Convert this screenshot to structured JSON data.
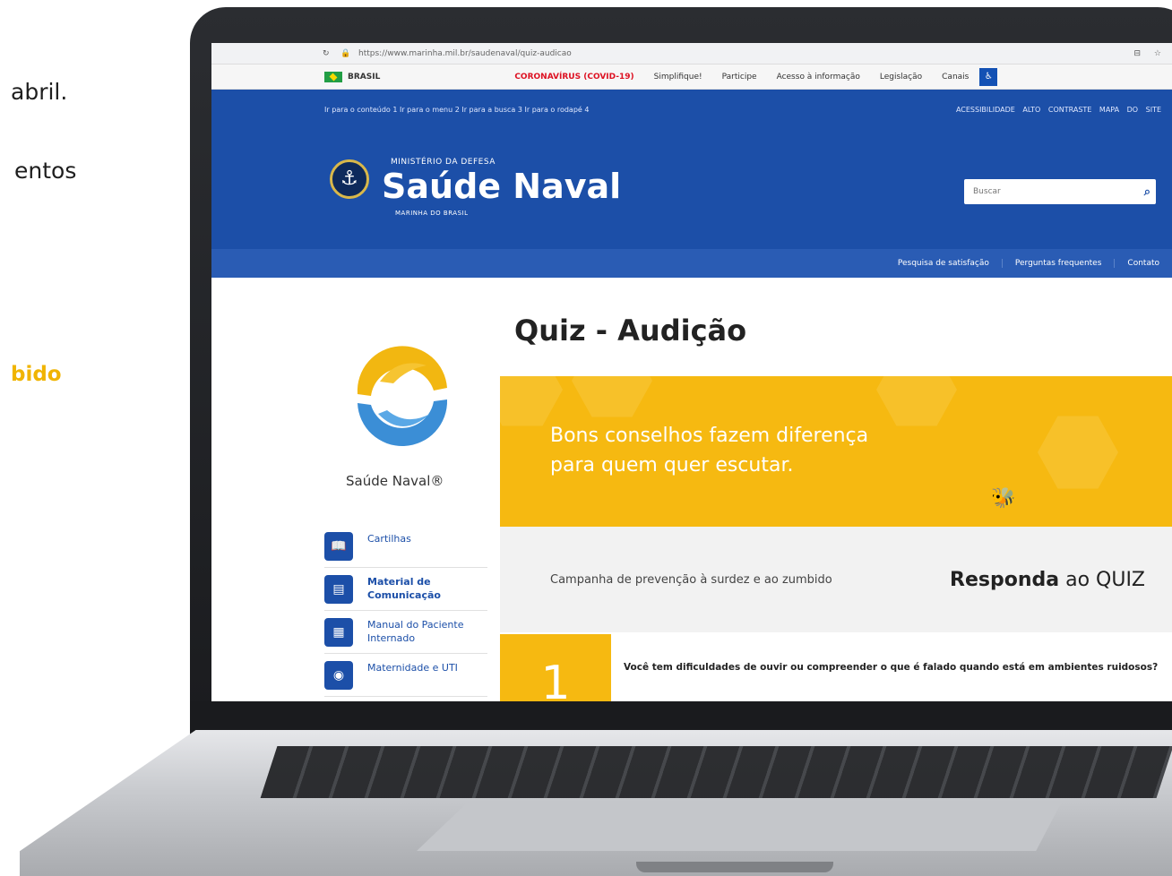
{
  "left_page": {
    "line1": "abril.",
    "line2": "entos",
    "line3": "bido"
  },
  "browser": {
    "url": "https://www.marinha.mil.br/saudenaval/quiz-audicao",
    "nav_icon": "reload-icon",
    "tools": "⊟ ☆"
  },
  "govbar": {
    "country": "BRASIL",
    "covid": "CORONAVÍRUS (COVID-19)",
    "links": [
      "Simplifique!",
      "Participe",
      "Acesso à informação",
      "Legislação",
      "Canais"
    ],
    "accessibility_btn": "♿"
  },
  "header": {
    "skip_links": "Ir para o conteúdo 1   Ir para o menu 2   Ir para a busca 3   Ir para o rodapé 4",
    "top_right": "ACESSIBILIDADE  ALTO CONTRASTE  MAPA DO SITE",
    "ministry": "MINISTÉRIO DA DEFESA",
    "title": "Saúde Naval",
    "subtitle": "MARINHA DO BRASIL",
    "search_placeholder": "Buscar",
    "emblem": "⚓"
  },
  "subnav": {
    "items": [
      "Pesquisa de satisfação",
      "Perguntas frequentes",
      "Contato"
    ]
  },
  "sidebar": {
    "logo_caption": "Saúde Naval®",
    "items": [
      {
        "label": "Cartilhas",
        "icon": "📖",
        "bold": false
      },
      {
        "label": "Material de Comunicação",
        "icon": "▤",
        "bold": true
      },
      {
        "label": "Manual do Paciente Internado",
        "icon": "▦",
        "bold": false
      },
      {
        "label": "Maternidade e UTI",
        "icon": "◉",
        "bold": false
      }
    ]
  },
  "main": {
    "title": "Quiz - Audição",
    "banner_line1": "Bons conselhos fazem diferença",
    "banner_line2": "para quem quer escutar.",
    "campaign_text": "Campanha de prevenção à surdez e ao zumbido",
    "cta_prefix": "Responda",
    "cta_suffix": " ao QUIZ",
    "question_number": "1",
    "question_text": "Você tem dificuldades de ouvir ou compreender o que é falado quando está em ambientes ruidosos?"
  },
  "colors": {
    "navy_blue": "#1c4fa8",
    "yellow": "#f6b911"
  }
}
